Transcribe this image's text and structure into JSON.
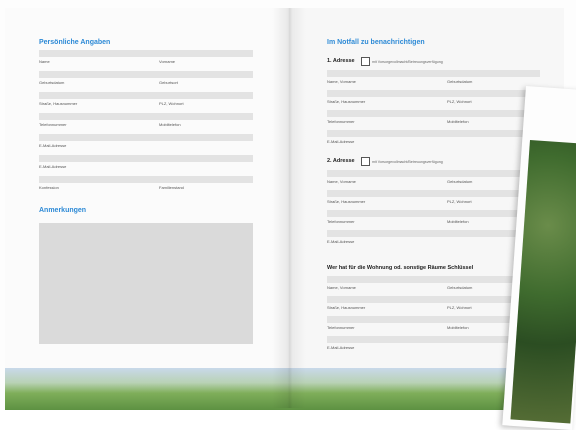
{
  "left_page": {
    "personal": {
      "heading": "Persönliche Angaben",
      "rows": [
        {
          "left": "Name",
          "right": "Vorname"
        },
        {
          "left": "Geburtsdatum",
          "right": "Geburtsort"
        },
        {
          "left": "Straße, Hausnummer",
          "right": "PLZ, Wohnort"
        },
        {
          "left": "Telefonnummer",
          "right": "Mobiltelefon"
        },
        {
          "left": "E-Mail-Adresse",
          "right": ""
        },
        {
          "left": "E-Mail-Adresse",
          "right": ""
        },
        {
          "left": "Konfession",
          "right": "Familienstand"
        }
      ]
    },
    "notes_heading": "Anmerkungen"
  },
  "right_page": {
    "heading": "Im Notfall zu benachrichtigen",
    "address1": {
      "title": "1. Adresse",
      "checkbox_label": "mit Vorsorgevollmacht/Betreuungsverfügung",
      "rows": [
        {
          "left": "Name, Vorname",
          "right": "Geburtsdatum"
        },
        {
          "left": "Straße, Hausnummer",
          "right": "PLZ, Wohnort"
        },
        {
          "left": "Telefonnummer",
          "right": "Mobiltelefon"
        },
        {
          "left": "E-Mail-Adresse",
          "right": ""
        }
      ]
    },
    "address2": {
      "title": "2. Adresse",
      "checkbox_label": "mit Vorsorgevollmacht/Betreuungsverfügung",
      "rows": [
        {
          "left": "Name, Vorname",
          "right": "Geburtsdatum"
        },
        {
          "left": "Straße, Hausnummer",
          "right": "PLZ, Wohnort"
        },
        {
          "left": "Telefonnummer",
          "right": "Mobiltelefon"
        },
        {
          "left": "E-Mail-Adresse",
          "right": ""
        }
      ]
    },
    "keys": {
      "title": "Wer hat für die Wohnung od. sonstige Räume Schlüssel",
      "rows": [
        {
          "left": "Name, Vorname",
          "right": "Geburtsdatum"
        },
        {
          "left": "Straße, Hausnummer",
          "right": "PLZ, Wohnort"
        },
        {
          "left": "Telefonnummer",
          "right": "Mobiltelefon"
        },
        {
          "left": "E-Mail-Adresse",
          "right": ""
        }
      ]
    }
  },
  "colors": {
    "heading": "#2d8ad6",
    "field_bar": "#e3e3e3",
    "notes_box": "#dadada"
  }
}
